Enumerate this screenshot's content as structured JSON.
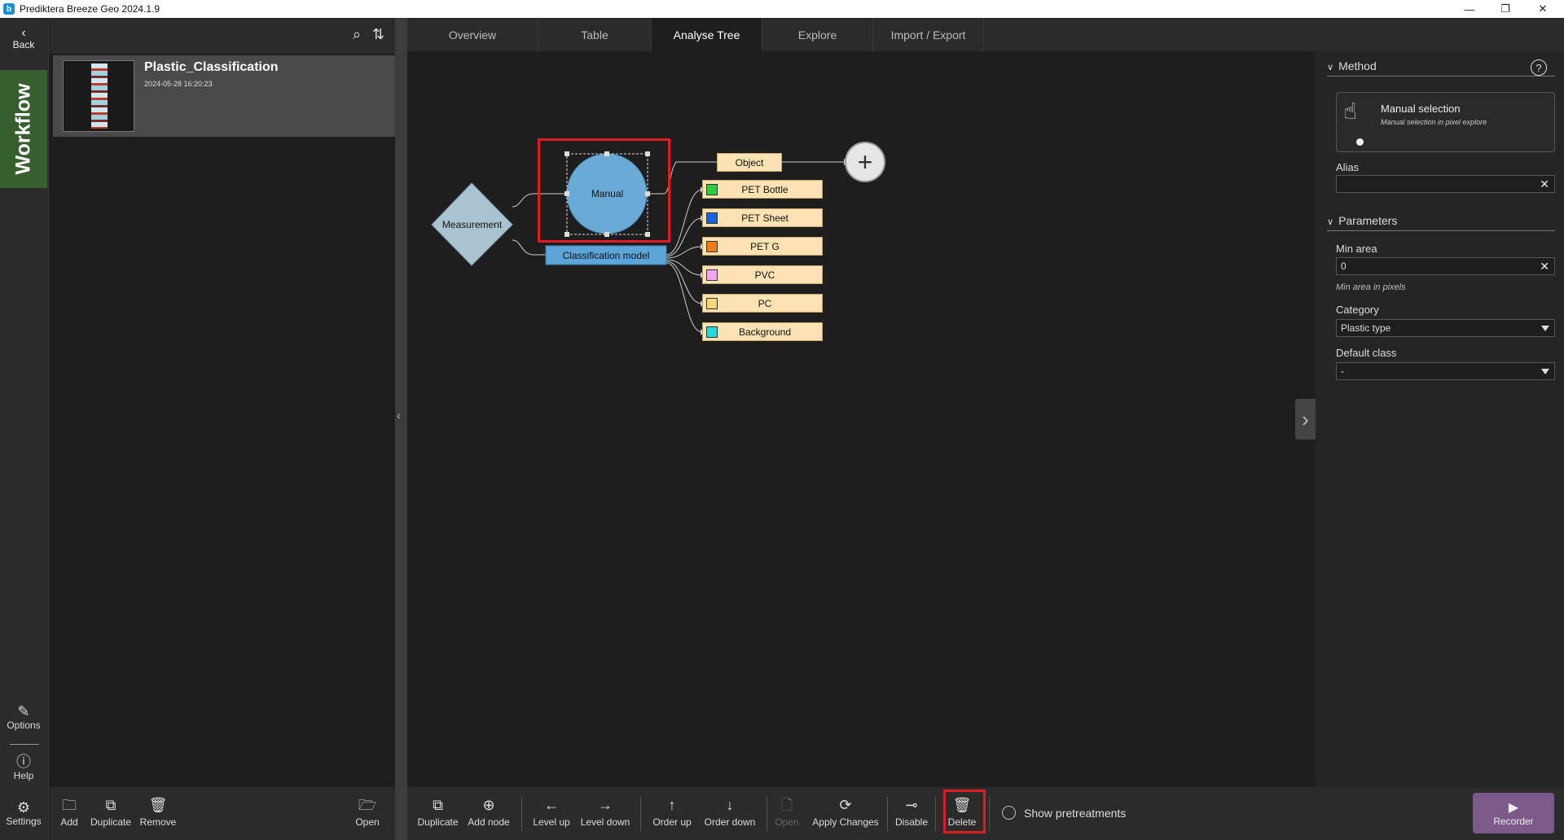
{
  "window": {
    "title": "Prediktera Breeze Geo 2024.1.9",
    "logo_letter": "b",
    "controls": {
      "minimize": "—",
      "restore": "❐",
      "close": "✕"
    }
  },
  "rail": {
    "back_label": "Back",
    "workflow_label": "Workflow",
    "options_label": "Options",
    "help_label": "Help",
    "settings_label": "Settings"
  },
  "project": {
    "name": "Plastic_Classification",
    "date": "2024-05-28 16:20:23"
  },
  "left_toolbar": {
    "add": "Add",
    "duplicate": "Duplicate",
    "remove": "Remove",
    "open": "Open"
  },
  "tabs": [
    {
      "label": "Overview"
    },
    {
      "label": "Table"
    },
    {
      "label": "Analyse Tree"
    },
    {
      "label": "Explore"
    },
    {
      "label": "Import / Export"
    }
  ],
  "tree": {
    "measurement": "Measurement",
    "manual": "Manual",
    "classification_model": "Classification model",
    "object": "Object",
    "classes": [
      {
        "label": "PET Bottle",
        "color": "#2ecc40"
      },
      {
        "label": "PET Sheet",
        "color": "#1565e0"
      },
      {
        "label": "PET G",
        "color": "#f07d1a"
      },
      {
        "label": "PVC",
        "color": "#f3a6f3"
      },
      {
        "label": "PC",
        "color": "#f6d77a"
      },
      {
        "label": "Background",
        "color": "#22d9e0"
      }
    ]
  },
  "canvas_toolbar": {
    "duplicate": "Duplicate",
    "add_node": "Add node",
    "level_up": "Level up",
    "level_down": "Level down",
    "order_up": "Order up",
    "order_down": "Order down",
    "open": "Open",
    "apply_changes": "Apply Changes",
    "disable": "Disable",
    "delete": "Delete",
    "show_pretreatments": "Show pretreatments"
  },
  "right_panel": {
    "method_header": "Method",
    "method_title": "Manual selection",
    "method_subtitle": "Manual selection in pixel explore",
    "alias_label": "Alias",
    "alias_value": "",
    "parameters_header": "Parameters",
    "min_area_label": "Min area",
    "min_area_value": "0",
    "min_area_hint": "Min area in pixels",
    "category_label": "Category",
    "category_value": "Plastic type",
    "default_class_label": "Default class",
    "default_class_value": "-",
    "recorder_label": "Recorder"
  },
  "colors": {
    "highlight": "#e01b24",
    "node_blue": "#6aaad6",
    "diamond": "#a9c3d1",
    "class_fill": "#fde3b3",
    "workflow_green": "#365e2e",
    "recorder": "#7b5a8a"
  }
}
